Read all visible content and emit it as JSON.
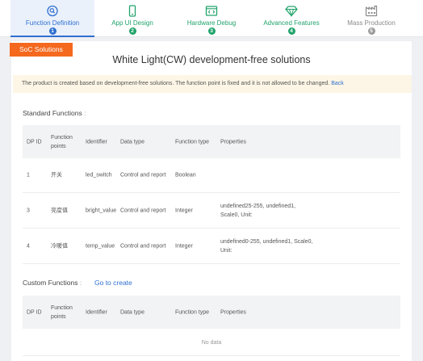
{
  "steps": [
    {
      "label": "Function Definition",
      "num": "1",
      "icon": "function-icon",
      "state": "active"
    },
    {
      "label": "App UI Design",
      "num": "2",
      "icon": "mobile-icon",
      "state": "done"
    },
    {
      "label": "Hardware Debug",
      "num": "3",
      "icon": "debug-icon",
      "state": "done"
    },
    {
      "label": "Advanced Features",
      "num": "4",
      "icon": "diamond-icon",
      "state": "done"
    },
    {
      "label": "Mass Production",
      "num": "5",
      "icon": "factory-icon",
      "state": "todo"
    }
  ],
  "badge": "SoC Solutions",
  "title": "White Light(CW) development-free solutions",
  "notice": {
    "text": "The product is created based on development-free solutions. The function point is fixed and it is not allowed to be changed.",
    "link": "Back"
  },
  "standard": {
    "title": "Standard Functions",
    "colon": ":",
    "headers": [
      "DP ID",
      "Function points",
      "Identifier",
      "Data type",
      "Function type",
      "Properties"
    ],
    "rows": [
      [
        "1",
        "开关",
        "led_switch",
        "Control and report",
        "Boolean",
        ""
      ],
      [
        "3",
        "亮度值",
        "bright_value",
        "Control and report",
        "Integer",
        "undefined25-255, undefined1, Scale0, Unit:"
      ],
      [
        "4",
        "冷暖值",
        "temp_value",
        "Control and report",
        "Integer",
        "undefined0-255, undefined1, Scale0, Unit:"
      ]
    ]
  },
  "custom": {
    "title": "Custom Functions",
    "colon": ":",
    "create_link": "Go to create",
    "headers": [
      "DP ID",
      "Function points",
      "Identifier",
      "Data type",
      "Function type",
      "Properties"
    ],
    "empty": "No data"
  },
  "colors": {
    "accent": "#2f6fcf",
    "done": "#21a36b",
    "badge": "#f4691e",
    "notice_bg": "#fdf6e6"
  }
}
